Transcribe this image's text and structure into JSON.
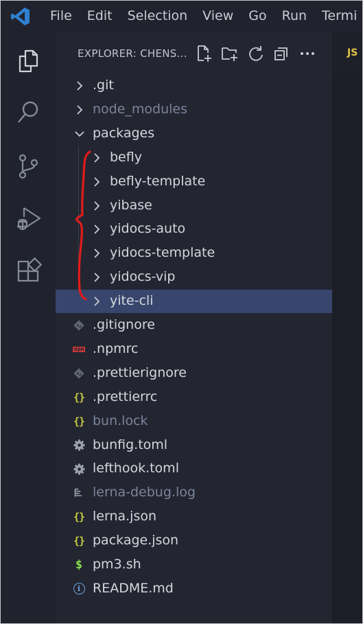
{
  "menu": [
    "File",
    "Edit",
    "Selection",
    "View",
    "Go",
    "Run",
    "Termi"
  ],
  "explorer": {
    "title": "EXPLORER: CHENS..."
  },
  "editor": {
    "tab_badge": "JS"
  },
  "tree": [
    {
      "label": ".git",
      "type": "folder",
      "level": 0,
      "dim": false
    },
    {
      "label": "node_modules",
      "type": "folder",
      "level": 0,
      "dim": true
    },
    {
      "label": "packages",
      "type": "folder-open",
      "level": 0,
      "dim": false
    },
    {
      "label": "befly",
      "type": "folder",
      "level": 1,
      "dim": false
    },
    {
      "label": "befly-template",
      "type": "folder",
      "level": 1,
      "dim": false
    },
    {
      "label": "yibase",
      "type": "folder",
      "level": 1,
      "dim": false
    },
    {
      "label": "yidocs-auto",
      "type": "folder",
      "level": 1,
      "dim": false
    },
    {
      "label": "yidocs-template",
      "type": "folder",
      "level": 1,
      "dim": false
    },
    {
      "label": "yidocs-vip",
      "type": "folder",
      "level": 1,
      "dim": false
    },
    {
      "label": "yite-cli",
      "type": "folder",
      "level": 1,
      "dim": false,
      "selected": true
    },
    {
      "label": ".gitignore",
      "type": "git",
      "level": 0,
      "dim": false
    },
    {
      "label": ".npmrc",
      "type": "npm",
      "level": 0,
      "dim": false,
      "icon_text": "npm"
    },
    {
      "label": ".prettierignore",
      "type": "git",
      "level": 0,
      "dim": false
    },
    {
      "label": ".prettierrc",
      "type": "json",
      "level": 0,
      "dim": false,
      "icon_text": "{}"
    },
    {
      "label": "bun.lock",
      "type": "json",
      "level": 0,
      "dim": true,
      "icon_text": "{}"
    },
    {
      "label": "bunfig.toml",
      "type": "gear",
      "level": 0,
      "dim": false
    },
    {
      "label": "lefthook.toml",
      "type": "gear",
      "level": 0,
      "dim": false
    },
    {
      "label": "lerna-debug.log",
      "type": "log",
      "level": 0,
      "dim": true
    },
    {
      "label": "lerna.json",
      "type": "json",
      "level": 0,
      "dim": false,
      "icon_text": "{}"
    },
    {
      "label": "package.json",
      "type": "json",
      "level": 0,
      "dim": false,
      "icon_text": "{}"
    },
    {
      "label": "pm3.sh",
      "type": "shell",
      "level": 0,
      "dim": false,
      "icon_text": "$"
    },
    {
      "label": "README.md",
      "type": "info",
      "level": 0,
      "dim": false,
      "icon_text": "i"
    }
  ],
  "colors": {
    "accent": "#2f80d0",
    "selection": "#38466d",
    "json_icon": "#cbcb41",
    "npm_icon": "#cb3837",
    "shell_icon": "#89e051",
    "annotation": "#e11b1b"
  }
}
